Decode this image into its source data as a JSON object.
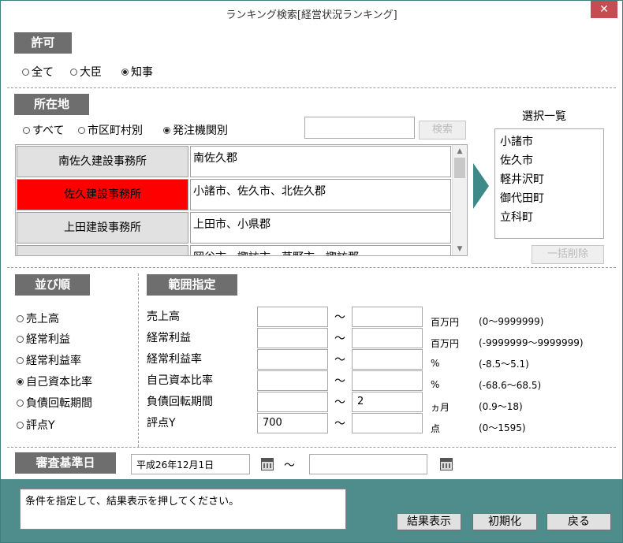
{
  "window": {
    "title": "ランキング検索[経営状況ランキング]",
    "close_glyph": "✕"
  },
  "permit": {
    "header": "許可",
    "options": [
      {
        "label": "全て",
        "selected": false
      },
      {
        "label": "大臣",
        "selected": false
      },
      {
        "label": "知事",
        "selected": true
      }
    ]
  },
  "location": {
    "header": "所在地",
    "options": [
      {
        "label": "すべて",
        "selected": false
      },
      {
        "label": "市区町村別",
        "selected": false
      },
      {
        "label": "発注機関別",
        "selected": true
      }
    ],
    "search_value": "",
    "search_button": "検索",
    "rows": [
      {
        "office": "南佐久建設事務所",
        "areas": "南佐久郡",
        "selected": false
      },
      {
        "office": "佐久建設事務所",
        "areas": "小諸市、佐久市、北佐久郡",
        "selected": true
      },
      {
        "office": "上田建設事務所",
        "areas": "上田市、小県郡",
        "selected": false
      },
      {
        "office": "",
        "areas": "岡谷市、諏訪市、茅野市、諏訪郡",
        "selected": false
      }
    ],
    "selection_title": "選択一覧",
    "selection": [
      "小諸市",
      "佐久市",
      "軽井沢町",
      "御代田町",
      "立科町"
    ],
    "clear_all_button": "一括削除"
  },
  "sort": {
    "header": "並び順",
    "options": [
      {
        "label": "売上高",
        "selected": false
      },
      {
        "label": "経常利益",
        "selected": false
      },
      {
        "label": "経常利益率",
        "selected": false
      },
      {
        "label": "自己資本比率",
        "selected": true
      },
      {
        "label": "負債回転期間",
        "selected": false
      },
      {
        "label": "評点Y",
        "selected": false
      }
    ]
  },
  "range": {
    "header": "範囲指定",
    "tilde": "～",
    "rows": [
      {
        "label": "売上高",
        "from": "",
        "to": "",
        "unit": "百万円",
        "hint": "(0～9999999)"
      },
      {
        "label": "経常利益",
        "from": "",
        "to": "",
        "unit": "百万円",
        "hint": "(-9999999～9999999)"
      },
      {
        "label": "経常利益率",
        "from": "",
        "to": "",
        "unit": "%",
        "hint": "(-8.5～5.1)"
      },
      {
        "label": "自己資本比率",
        "from": "",
        "to": "",
        "unit": "%",
        "hint": "(-68.6～68.5)"
      },
      {
        "label": "負債回転期間",
        "from": "",
        "to": "2",
        "unit": "ヵ月",
        "hint": "(0.9～18)"
      },
      {
        "label": "評点Y",
        "from": "700",
        "to": "",
        "unit": "点",
        "hint": "(0～1595)"
      }
    ]
  },
  "review_date": {
    "header": "審査基準日",
    "from": "平成26年12月1日",
    "to": "",
    "tilde": "～"
  },
  "footer": {
    "message": "条件を指定して、結果表示を押してください。",
    "buttons": {
      "show": "結果表示",
      "reset": "初期化",
      "back": "戻る"
    }
  },
  "colors": {
    "accent": "#4e8d8b",
    "header": "#6e6e6e",
    "selected_row": "#ff0000",
    "close": "#c74b50"
  }
}
